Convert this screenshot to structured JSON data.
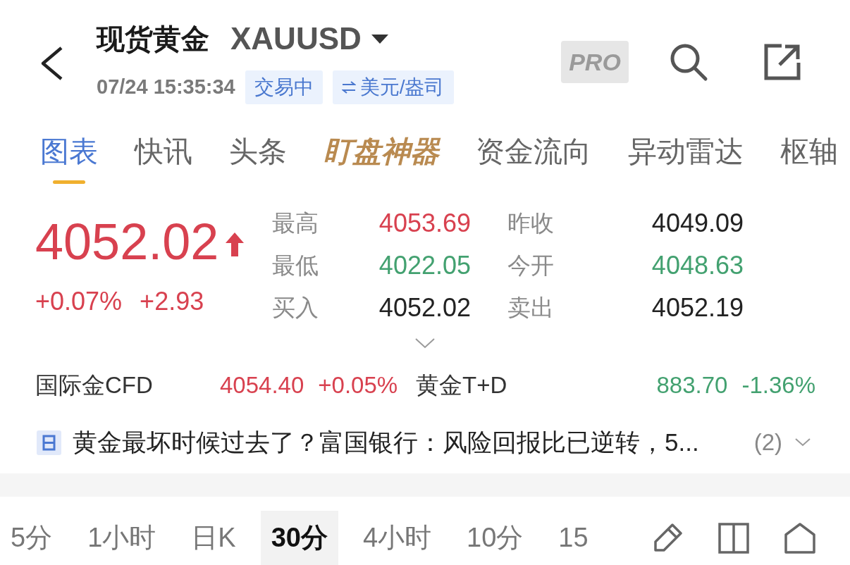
{
  "header": {
    "title": "现货黄金",
    "symbol": "XAUUSD",
    "time": "07/24 15:35:34",
    "badges": [
      {
        "kind": "status",
        "label": "交易中"
      },
      {
        "kind": "unit",
        "label": "美元/盎司"
      }
    ],
    "pro_badge": "PRO"
  },
  "tabs": [
    {
      "label": "图表",
      "selected": true,
      "kind": "normal"
    },
    {
      "label": "快讯",
      "selected": false,
      "kind": "normal"
    },
    {
      "label": "头条",
      "selected": false,
      "kind": "normal"
    },
    {
      "label": "盯盘神器",
      "selected": false,
      "kind": "promo"
    },
    {
      "label": "资金流向",
      "selected": false,
      "kind": "normal"
    },
    {
      "label": "异动雷达",
      "selected": false,
      "kind": "normal"
    },
    {
      "label": "枢轴",
      "selected": false,
      "kind": "normal"
    }
  ],
  "quote": {
    "price": "4052.02",
    "rising": true,
    "change_percent": "+0.07%",
    "change": "+2.93"
  },
  "stats": [
    {
      "label": "最高",
      "value": "4053.69",
      "color": "#d8414f"
    },
    {
      "label": "昨收",
      "value": "4049.09",
      "color": "#222222"
    },
    {
      "label": "最低",
      "value": "4022.05",
      "color": "#43a170"
    },
    {
      "label": "今开",
      "value": "4048.63",
      "color": "#43a170"
    },
    {
      "label": "买入",
      "value": "4052.02",
      "color": "#222222"
    },
    {
      "label": "卖出",
      "value": "4052.19",
      "color": "#222222"
    }
  ],
  "markets": [
    {
      "name": "国际金CFD",
      "price": "4054.40",
      "change": "+0.05%",
      "color": "#d8414f"
    },
    {
      "name": "黄金T+D",
      "price": "883.70",
      "change": "-1.36%",
      "color": "#43a170"
    }
  ],
  "news": {
    "headline": "黄金最坏时候过去了？富国银行：风险回报比已逆转，5...",
    "count": "(2)"
  },
  "intervals": [
    {
      "label": "5分",
      "selected": false
    },
    {
      "label": "1小时",
      "selected": false
    },
    {
      "label": "日K",
      "selected": false
    },
    {
      "label": "30分",
      "selected": true
    },
    {
      "label": "4小时",
      "selected": false
    },
    {
      "label": "10分",
      "selected": false
    },
    {
      "label": "15",
      "selected": false
    }
  ]
}
